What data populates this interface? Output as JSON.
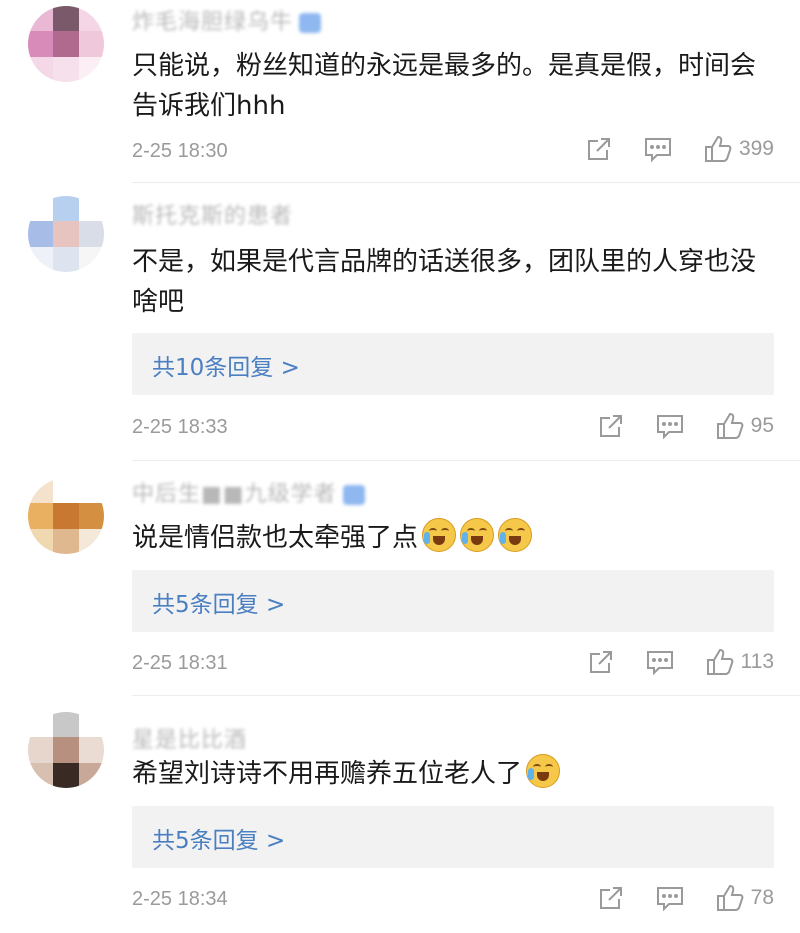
{
  "comments": [
    {
      "username": "炸毛海胆绿乌牛",
      "text": "只能说，粉丝知道的永远是最多的。是真是假，时间会告诉我们hhh",
      "time": "2-25 18:30",
      "likes": "399",
      "replies": ""
    },
    {
      "username": "斯托克斯的患者",
      "text": "不是，如果是代言品牌的话送很多，团队里的人穿也没啥吧",
      "time": "2-25 18:33",
      "likes": "95",
      "replies": "共10条回复 >"
    },
    {
      "username": "中后生■■九级学者",
      "text": "说是情侣款也太牵强了点",
      "emoji_count": 3,
      "time": "2-25 18:31",
      "likes": "113",
      "replies": "共5条回复 >"
    },
    {
      "username": "星是比比酒",
      "text": "希望刘诗诗不用再赡养五位老人了",
      "emoji_count": 1,
      "time": "2-25 18:34",
      "likes": "78",
      "replies": "共5条回复 >"
    }
  ],
  "icons": {
    "share": "share-icon",
    "comment": "comment-icon",
    "like": "thumbs-up-icon",
    "emoji": "crying-laughing-emoji"
  },
  "colors": {
    "link": "#4a7fc1",
    "meta": "#9a9a9a",
    "reply_bg": "#f2f2f2"
  }
}
